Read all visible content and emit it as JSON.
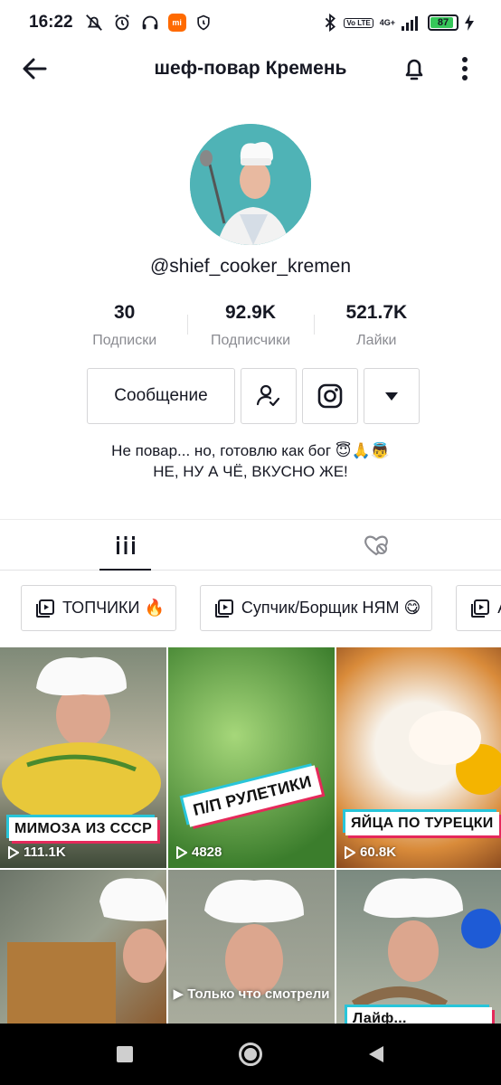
{
  "status_bar": {
    "time": "16:22",
    "network": "4G+",
    "volte": "Vo LTE",
    "battery": "87",
    "battery_level": 0.87,
    "mi_badge": "mi"
  },
  "header": {
    "title": "шеф-повар Кремень",
    "icons": [
      "back-arrow-icon",
      "bell-icon",
      "more-vertical-icon"
    ]
  },
  "profile": {
    "username": "@shief_cooker_kremen",
    "stats": [
      {
        "value": "30",
        "label": "Подписки"
      },
      {
        "value": "92.9K",
        "label": "Подписчики"
      },
      {
        "value": "521.7K",
        "label": "Лайки"
      }
    ],
    "actions": {
      "message_label": "Сообщение"
    },
    "bio": [
      "Не повар... но, готовлю как бог 😇🙏👼",
      "НЕ, НУ А ЧЁ, ВКУСНО ЖЕ!"
    ]
  },
  "playlists": [
    {
      "label": "ТОПЧИКИ 🔥"
    },
    {
      "label": "Супчик/Борщик НЯМ 😋"
    },
    {
      "label": "А"
    }
  ],
  "videos": [
    {
      "caption": "МИМОЗА ИЗ СССР",
      "views": "111.1K"
    },
    {
      "caption": "П/П РУЛЕТИКИ",
      "views": "4828"
    },
    {
      "caption": "ЯЙЦА ПО ТУРЕЦКИ",
      "views": "60.8K"
    },
    {
      "caption": "",
      "views": ""
    },
    {
      "caption": "",
      "views": "",
      "overlay": "▶ Только что смотрели"
    },
    {
      "caption": "Лайф...",
      "views": ""
    }
  ],
  "colors": {
    "accent_red": "#e5295a",
    "accent_cyan": "#28c5d9",
    "avatar_bg": "#4fb3b6"
  }
}
